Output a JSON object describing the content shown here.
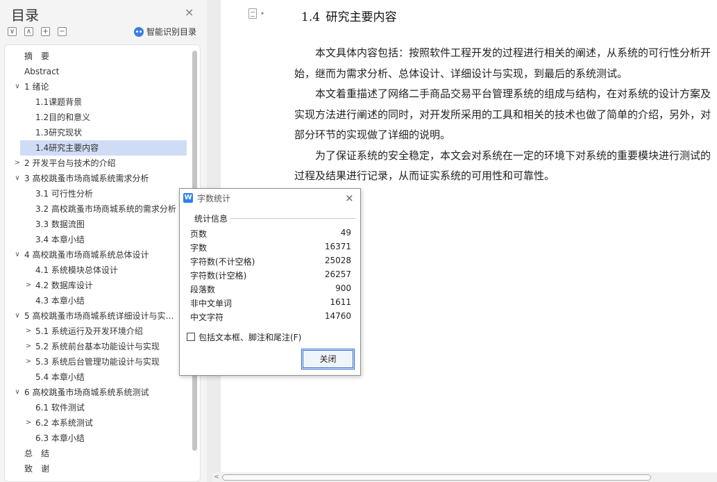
{
  "nav": {
    "title": "目录",
    "close_glyph": "×",
    "tools": [
      "∨",
      "∧",
      "+",
      "−"
    ],
    "smart_label": "智能识别目录",
    "toc": [
      {
        "label": "摘　要",
        "level": 0,
        "caret": ""
      },
      {
        "label": "Abstract",
        "level": 0,
        "caret": ""
      },
      {
        "label": "1 绪论",
        "level": 0,
        "caret": "∨"
      },
      {
        "label": "1.1课题背景",
        "level": 1,
        "caret": ""
      },
      {
        "label": "1.2目的和意义",
        "level": 1,
        "caret": ""
      },
      {
        "label": "1.3研究现状",
        "level": 1,
        "caret": ""
      },
      {
        "label": "1.4研究主要内容",
        "level": 1,
        "caret": "",
        "selected": true
      },
      {
        "label": "2 开发平台与技术的介绍",
        "level": 0,
        "caret": ">"
      },
      {
        "label": "3  高校跳蚤市场商城系统需求分析",
        "level": 0,
        "caret": "∨"
      },
      {
        "label": "3.1 可行性分析",
        "level": 1,
        "caret": ""
      },
      {
        "label": "3.2 高校跳蚤市场商城系统的需求分析",
        "level": 1,
        "caret": ""
      },
      {
        "label": "3.3 数据流图",
        "level": 1,
        "caret": ""
      },
      {
        "label": "3.4 本章小结",
        "level": 1,
        "caret": ""
      },
      {
        "label": "4  高校跳蚤市场商城系统总体设计",
        "level": 0,
        "caret": "∨"
      },
      {
        "label": "4.1 系统模块总体设计",
        "level": 1,
        "caret": ""
      },
      {
        "label": "4.2 数据库设计",
        "level": 1,
        "caret": ">"
      },
      {
        "label": "4.3 本章小结",
        "level": 1,
        "caret": ""
      },
      {
        "label": "5  高校跳蚤市场商城系统详细设计与实…",
        "level": 0,
        "caret": "∨"
      },
      {
        "label": "5.1 系统运行及开发环境介绍",
        "level": 1,
        "caret": ">"
      },
      {
        "label": "5.2 系统前台基本功能设计与实现",
        "level": 1,
        "caret": ">"
      },
      {
        "label": "5.3 系统后台管理功能设计与实现",
        "level": 1,
        "caret": ">"
      },
      {
        "label": "5.4 本章小结",
        "level": 1,
        "caret": ""
      },
      {
        "label": "6  高校跳蚤市场商城系统系统测试",
        "level": 0,
        "caret": "∨"
      },
      {
        "label": "6.1 软件测试",
        "level": 1,
        "caret": ""
      },
      {
        "label": "6.2 本系统测试",
        "level": 1,
        "caret": ">"
      },
      {
        "label": "6.3 本章小结",
        "level": 1,
        "caret": ""
      },
      {
        "label": "总　结",
        "level": 0,
        "caret": ""
      },
      {
        "label": "致　谢",
        "level": 0,
        "caret": ""
      }
    ]
  },
  "doc": {
    "heading": "1.4 研究主要内容",
    "paragraphs": [
      "本文具体内容包括：按照软件工程开发的过程进行相关的阐述，从系统的可行性分析开始，继而为需求分析、总体设计、详细设计与实现，到最后的系统测试。",
      "本文着重描述了网络二手商品交易平台管理系统的组成与结构，在对系统的设计方案及实现方法进行阐述的同时，对开发所采用的工具和相关的技术也做了简单的介绍，另外，对部分环节的实现做了详细的说明。",
      "为了保证系统的安全稳定，本文会对系统在一定的环境下对系统的重要模块进行测试的过程及结果进行记录，从而证实系统的可用性和可靠性。"
    ],
    "scroll_arrow": "<"
  },
  "dialog": {
    "icon_text": "W",
    "title": "字数统计",
    "close_glyph": "×",
    "section": "统计信息",
    "stats": [
      {
        "label": "页数",
        "value": "49"
      },
      {
        "label": "字数",
        "value": "16371"
      },
      {
        "label": "字符数(不计空格)",
        "value": "25028"
      },
      {
        "label": "字符数(计空格)",
        "value": "26257"
      },
      {
        "label": "段落数",
        "value": "900"
      },
      {
        "label": "非中文单词",
        "value": "1611"
      },
      {
        "label": "中文字符",
        "value": "14760"
      }
    ],
    "checkbox_label": "包括文本框、脚注和尾注(F)",
    "checkbox_checked": false,
    "close_button": "关闭"
  }
}
